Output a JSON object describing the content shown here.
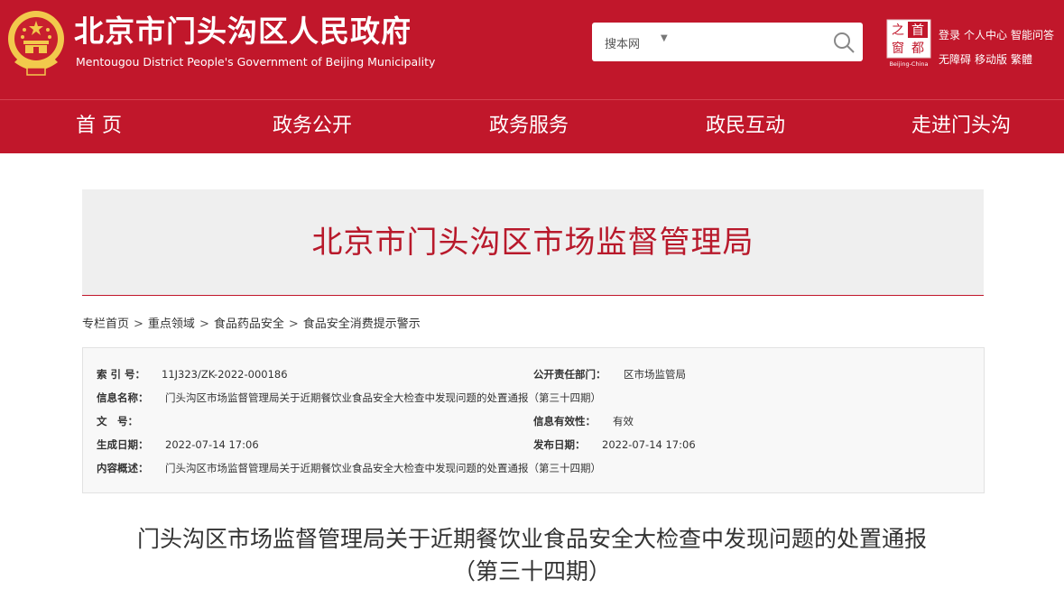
{
  "header": {
    "site_title": "北京市门头沟区人民政府",
    "site_subtitle": "Mentougou District People's Government of Beijing Municipality",
    "search_scope": "搜本网",
    "search_placeholder": "",
    "logo_chars": [
      "首",
      "都",
      "之",
      "窗"
    ],
    "logo_caption": "Beijing-China",
    "links_row1": [
      "登录",
      "个人中心",
      "智能问答"
    ],
    "links_row2": [
      "无障碍",
      "移动版",
      "繁體"
    ]
  },
  "nav": [
    "首 页",
    "政务公开",
    "政务服务",
    "政民互动",
    "走进门头沟"
  ],
  "banner": {
    "title": "北京市门头沟区市场监督管理局"
  },
  "breadcrumb": [
    "专栏首页",
    "重点领域",
    "食品药品安全",
    "食品安全消费提示警示"
  ],
  "breadcrumb_separator": ">",
  "info": {
    "index_label": "索 引 号：",
    "index_value": "11J323/ZK-2022-000186",
    "dept_label": "公开责任部门：",
    "dept_value": "区市场监管局",
    "name_label": "信息名称：",
    "name_value": "门头沟区市场监督管理局关于近期餐饮业食品安全大检查中发现问题的处置通报（第三十四期）",
    "doc_label": "文　号：",
    "doc_value": "",
    "validity_label": "信息有效性：",
    "validity_value": "有效",
    "created_label": "生成日期：",
    "created_value": "2022-07-14 17:06",
    "published_label": "发布日期：",
    "published_value": "2022-07-14 17:06",
    "summary_label": "内容概述：",
    "summary_value": "门头沟区市场监督管理局关于近期餐饮业食品安全大检查中发现问题的处置通报（第三十四期）"
  },
  "article": {
    "title_line1": "门头沟区市场监督管理局关于近期餐饮业食品安全大检查中发现问题的处置通报",
    "title_line2": "（第三十四期）"
  },
  "colors": {
    "brand_red": "#c1172b",
    "banner_bg": "#efefef",
    "gold": "#f2c94c"
  },
  "icons": [
    "national-emblem-icon",
    "search-icon",
    "dropdown-caret-icon",
    "capital-window-logo"
  ]
}
